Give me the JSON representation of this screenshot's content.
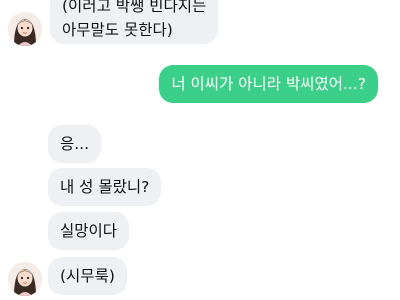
{
  "messages": [
    {
      "sender": "partner",
      "lines": [
        "(이러고 박쌩 빈다지는",
        "아무말도 못한다)"
      ]
    },
    {
      "sender": "me",
      "lines": [
        "너 이씨가 아니라 박씨였어...?"
      ]
    },
    {
      "sender": "partner",
      "lines": [
        "응..."
      ]
    },
    {
      "sender": "partner",
      "lines": [
        "내 성 몰랐니?"
      ]
    },
    {
      "sender": "partner",
      "lines": [
        "실망이다"
      ]
    },
    {
      "sender": "partner",
      "lines": [
        "(시무룩)"
      ]
    }
  ],
  "colors": {
    "partner_bubble": "#eef0f3",
    "my_bubble": "#3bcf8a",
    "my_text": "#ffffff",
    "partner_text": "#111111"
  },
  "avatar": {
    "icon": "girl-avatar-icon"
  }
}
